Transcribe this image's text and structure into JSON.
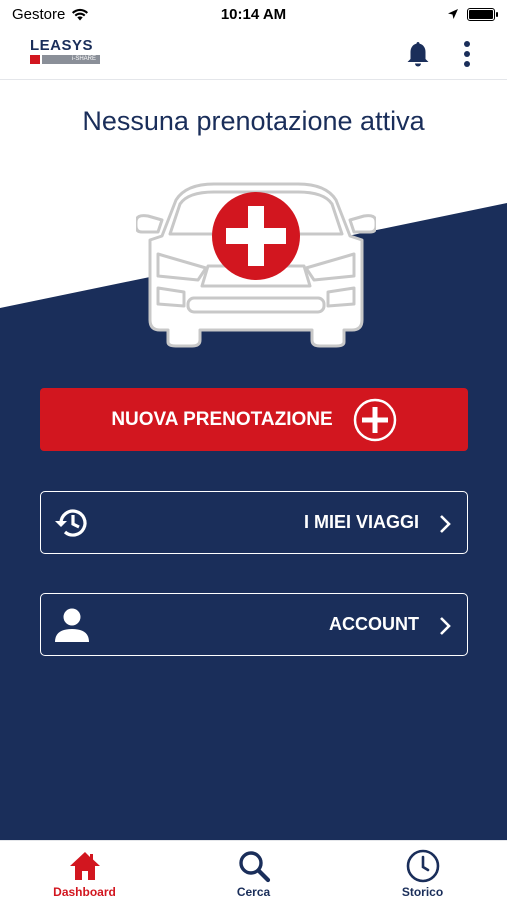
{
  "status_bar": {
    "carrier": "Gestore",
    "time": "10:14 AM",
    "battery_level": 1.0
  },
  "header": {
    "logo_text": "LEASYS",
    "logo_sub": "i-SHARE"
  },
  "main": {
    "title": "Nessuna prenotazione attiva",
    "new_booking_label": "NUOVA PRENOTAZIONE",
    "trips_label": "I MIEI VIAGGI",
    "account_label": "ACCOUNT"
  },
  "tabs": [
    {
      "label": "Dashboard",
      "icon": "home-icon",
      "active": true
    },
    {
      "label": "Cerca",
      "icon": "search-icon",
      "active": false
    },
    {
      "label": "Storico",
      "icon": "clock-icon",
      "active": false
    }
  ],
  "colors": {
    "navy": "#1a2e5a",
    "red": "#d2161f",
    "white": "#ffffff"
  }
}
